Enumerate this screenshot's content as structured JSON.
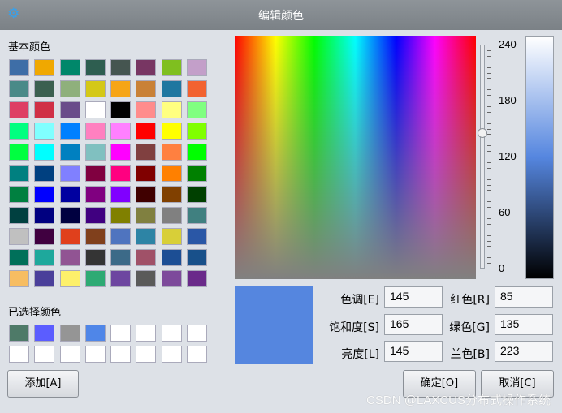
{
  "window": {
    "title": "编辑颜色",
    "icon": "gear-icon"
  },
  "basic_colors_label": "基本颜色",
  "basic_colors": [
    "#3e6ea7",
    "#f0a800",
    "#00876a",
    "#2e5e50",
    "#455550",
    "#783663",
    "#7fbf1f",
    "#c39fc9",
    "#4a8a88",
    "#3b6050",
    "#8fb07c",
    "#d4c817",
    "#f6a516",
    "#c98136",
    "#1f77a0",
    "#f26230",
    "#de3e64",
    "#d03046",
    "#6a4c8a",
    "#ffffff",
    "#000000",
    "#ff8c8c",
    "#ffff80",
    "#80ff80",
    "#00ff80",
    "#80ffff",
    "#0080ff",
    "#ff80c0",
    "#ff80ff",
    "#ff0000",
    "#ffff00",
    "#80ff00",
    "#00ff40",
    "#00ffff",
    "#0080c0",
    "#80c0c0",
    "#ff00ff",
    "#804040",
    "#ff8040",
    "#00ff00",
    "#008080",
    "#004080",
    "#8080ff",
    "#800040",
    "#ff0080",
    "#800000",
    "#ff8000",
    "#008000",
    "#008040",
    "#0000ff",
    "#0000a0",
    "#800080",
    "#8000ff",
    "#400000",
    "#804000",
    "#004000",
    "#004040",
    "#000080",
    "#000040",
    "#400080",
    "#808000",
    "#808040",
    "#808080",
    "#408080",
    "#c0c0c0",
    "#400040",
    "#e0401c",
    "#80401c",
    "#4f74bf",
    "#2d84a5",
    "#d8cf38",
    "#2a57a6",
    "#00705a",
    "#1ea89c",
    "#915493",
    "#343434",
    "#3c6a88",
    "#a05168",
    "#1c4e94",
    "#18508a",
    "#f7bd62",
    "#4a3f9a",
    "#fdf06a",
    "#2eaa74",
    "#6d46a0",
    "#5a5a5a",
    "#7d4a9b",
    "#6a2a8a"
  ],
  "custom_colors_label": "已选择颜色",
  "custom_colors": [
    "#4e7a68",
    "#5b5dff",
    "#959595",
    "#4f86e8",
    "#ffffff",
    "#ffffff",
    "#ffffff",
    "#ffffff",
    "#ffffff",
    "#ffffff",
    "#ffffff",
    "#ffffff",
    "#ffffff",
    "#ffffff",
    "#ffffff",
    "#ffffff"
  ],
  "add_button": "添加[A]",
  "preview_color": "#5586df",
  "luminance_ticks": [
    "240",
    "180",
    "120",
    "60",
    "0"
  ],
  "slider_value": 145,
  "fields": {
    "hue": {
      "label": "色调[E]",
      "value": "145"
    },
    "sat": {
      "label": "饱和度[S]",
      "value": "165"
    },
    "lum": {
      "label": "亮度[L]",
      "value": "145"
    },
    "red": {
      "label": "红色[R]",
      "value": "85"
    },
    "green": {
      "label": "绿色[G]",
      "value": "135"
    },
    "blue": {
      "label": "兰色[B]",
      "value": "223"
    }
  },
  "ok_button": "确定[O]",
  "cancel_button": "取消[C]",
  "watermark": "CSDN @LAXCUS分布式操作系统"
}
